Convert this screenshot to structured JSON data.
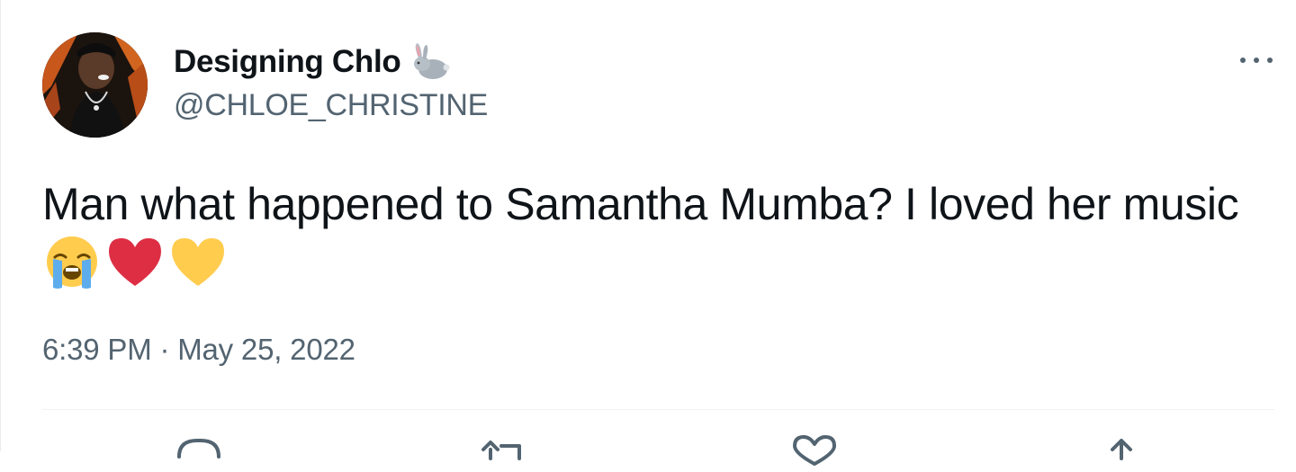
{
  "tweet": {
    "author": {
      "display_name": "Designing Chlo",
      "handle": "@CHLOE_CHRISTINE",
      "name_emoji": "rabbit-icon"
    },
    "text_main": "Man what happened to Samantha Mumba? I loved her music",
    "emojis": [
      "loudly-crying-face-icon",
      "red-heart-icon",
      "yellow-heart-icon"
    ],
    "timestamp": "6:39 PM · May 25, 2022",
    "actions": [
      "reply-icon",
      "retweet-icon",
      "like-icon",
      "share-icon"
    ]
  },
  "colors": {
    "text_primary": "#0f1419",
    "text_secondary": "#536471",
    "divider": "#eff3f4"
  }
}
